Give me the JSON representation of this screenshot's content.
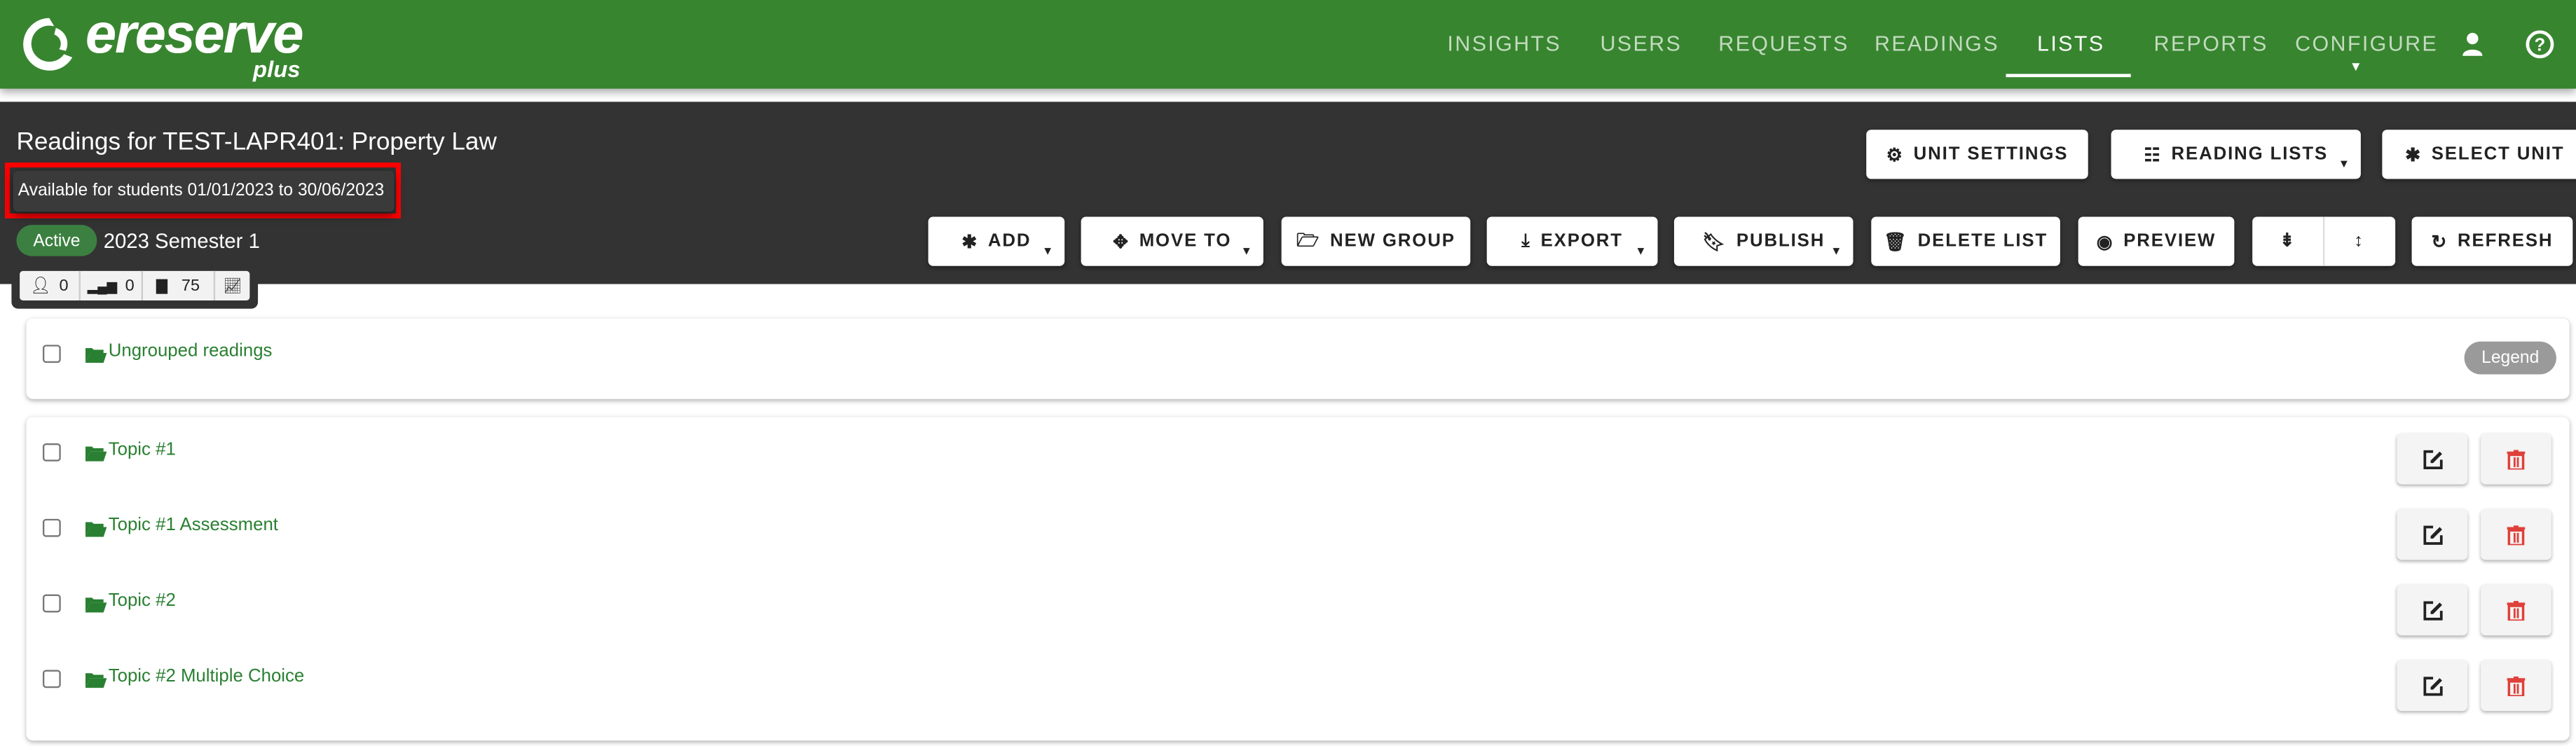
{
  "brand": {
    "name": "ereserve",
    "sub": "plus"
  },
  "nav": [
    {
      "label": "INSIGHTS"
    },
    {
      "label": "USERS"
    },
    {
      "label": "REQUESTS"
    },
    {
      "label": "READINGS"
    },
    {
      "label": "LISTS",
      "active": true
    },
    {
      "label": "REPORTS"
    },
    {
      "label": "CONFIGURE",
      "has_dropdown": true
    }
  ],
  "header": {
    "title": "Readings for TEST-LAPR401: Property Law",
    "tooltip": "Available for students 01/01/2023 to 30/06/2023",
    "status": "Active",
    "period": "2023 Semester 1",
    "stats": {
      "users": "0",
      "signal": "0",
      "documents": "75"
    }
  },
  "toolbar_top": {
    "unit_settings": "UNIT SETTINGS",
    "reading_lists": "READING LISTS",
    "select_unit": "SELECT UNIT"
  },
  "toolbar": {
    "add": "ADD",
    "move_to": "MOVE TO",
    "new_group": "NEW GROUP",
    "export": "EXPORT",
    "publish": "PUBLISH",
    "delete_list": "DELETE LIST",
    "preview": "PREVIEW",
    "refresh": "REFRESH"
  },
  "ungrouped": {
    "label": "Ungrouped readings",
    "legend": "Legend"
  },
  "groups": [
    {
      "label": "Topic #1"
    },
    {
      "label": "Topic #1 Assessment"
    },
    {
      "label": "Topic #2"
    },
    {
      "label": "Topic #2 Multiple Choice"
    }
  ],
  "colors": {
    "brand": "#388530",
    "panel": "#333333",
    "link": "#2a8032",
    "delete": "#e0403a",
    "highlight": "#ff0000"
  }
}
